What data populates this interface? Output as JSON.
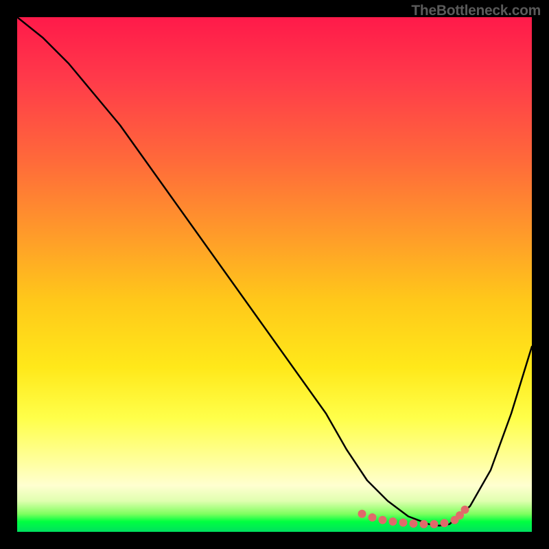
{
  "watermark": "TheBottleneck.com",
  "chart_data": {
    "type": "line",
    "title": "",
    "xlabel": "",
    "ylabel": "",
    "xlim": [
      0,
      100
    ],
    "ylim": [
      0,
      100
    ],
    "series": [
      {
        "name": "bottleneck-curve",
        "x": [
          0,
          5,
          10,
          15,
          20,
          25,
          30,
          35,
          40,
          45,
          50,
          55,
          60,
          64,
          68,
          72,
          76,
          80,
          82,
          84,
          88,
          92,
          96,
          100
        ],
        "values": [
          100,
          96,
          91,
          85,
          79,
          72,
          65,
          58,
          51,
          44,
          37,
          30,
          23,
          16,
          10,
          6,
          3,
          1.5,
          1.2,
          1.5,
          5,
          12,
          23,
          36
        ],
        "color": "#000000"
      },
      {
        "name": "optimal-zone-markers",
        "x": [
          67,
          69,
          71,
          73,
          75,
          77,
          79,
          81,
          83,
          85,
          86,
          87
        ],
        "values": [
          3.5,
          2.8,
          2.3,
          2.0,
          1.8,
          1.6,
          1.5,
          1.5,
          1.7,
          2.3,
          3.2,
          4.3
        ],
        "color": "#e06a6a",
        "marker": "dot"
      }
    ]
  },
  "colors": {
    "background": "#000000",
    "curve": "#000000",
    "markers": "#e06a6a"
  }
}
